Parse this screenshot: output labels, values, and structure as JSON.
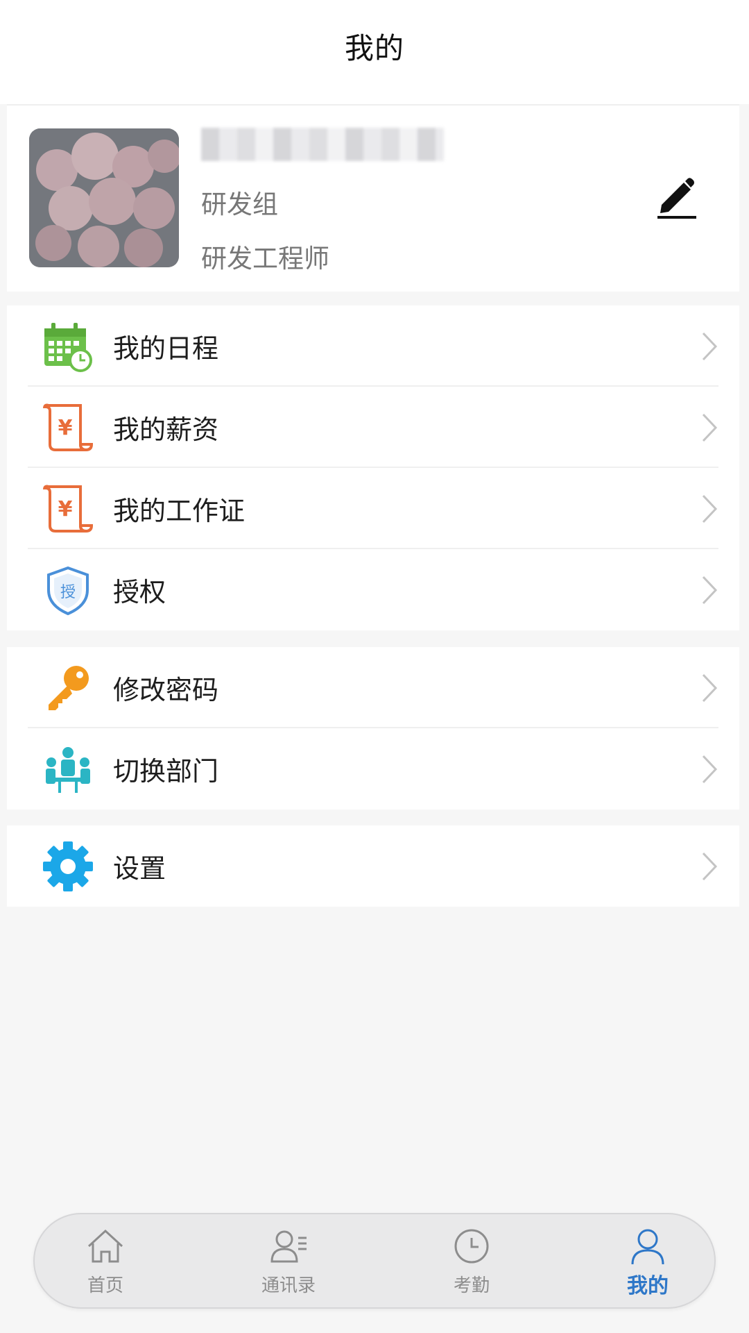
{
  "header": {
    "title": "我的"
  },
  "profile": {
    "department": "研发组",
    "position": "研发工程师"
  },
  "menu_group_1": [
    {
      "label": "我的日程",
      "icon": "calendar-clock-icon",
      "color": "#6cc04a"
    },
    {
      "label": "我的薪资",
      "icon": "salary-scroll-icon",
      "color": "#e86d3a"
    },
    {
      "label": "我的工作证",
      "icon": "work-badge-scroll-icon",
      "color": "#e86d3a"
    },
    {
      "label": "授权",
      "icon": "authorize-shield-icon",
      "color": "#4a90d9"
    }
  ],
  "menu_group_2": [
    {
      "label": "修改密码",
      "icon": "key-icon",
      "color": "#f39a1e"
    },
    {
      "label": "切换部门",
      "icon": "switch-department-icon",
      "color": "#2bb5c4"
    }
  ],
  "menu_group_3": [
    {
      "label": "设置",
      "icon": "gear-icon",
      "color": "#1ba7e8"
    }
  ],
  "tabbar": {
    "tabs": [
      {
        "label": "首页",
        "icon": "home-icon"
      },
      {
        "label": "通讯录",
        "icon": "contacts-icon"
      },
      {
        "label": "考勤",
        "icon": "clock-icon"
      },
      {
        "label": "我的",
        "icon": "user-icon",
        "active": true
      }
    ],
    "active_color": "#2e77c8",
    "inactive_color": "#8d8d8d"
  }
}
